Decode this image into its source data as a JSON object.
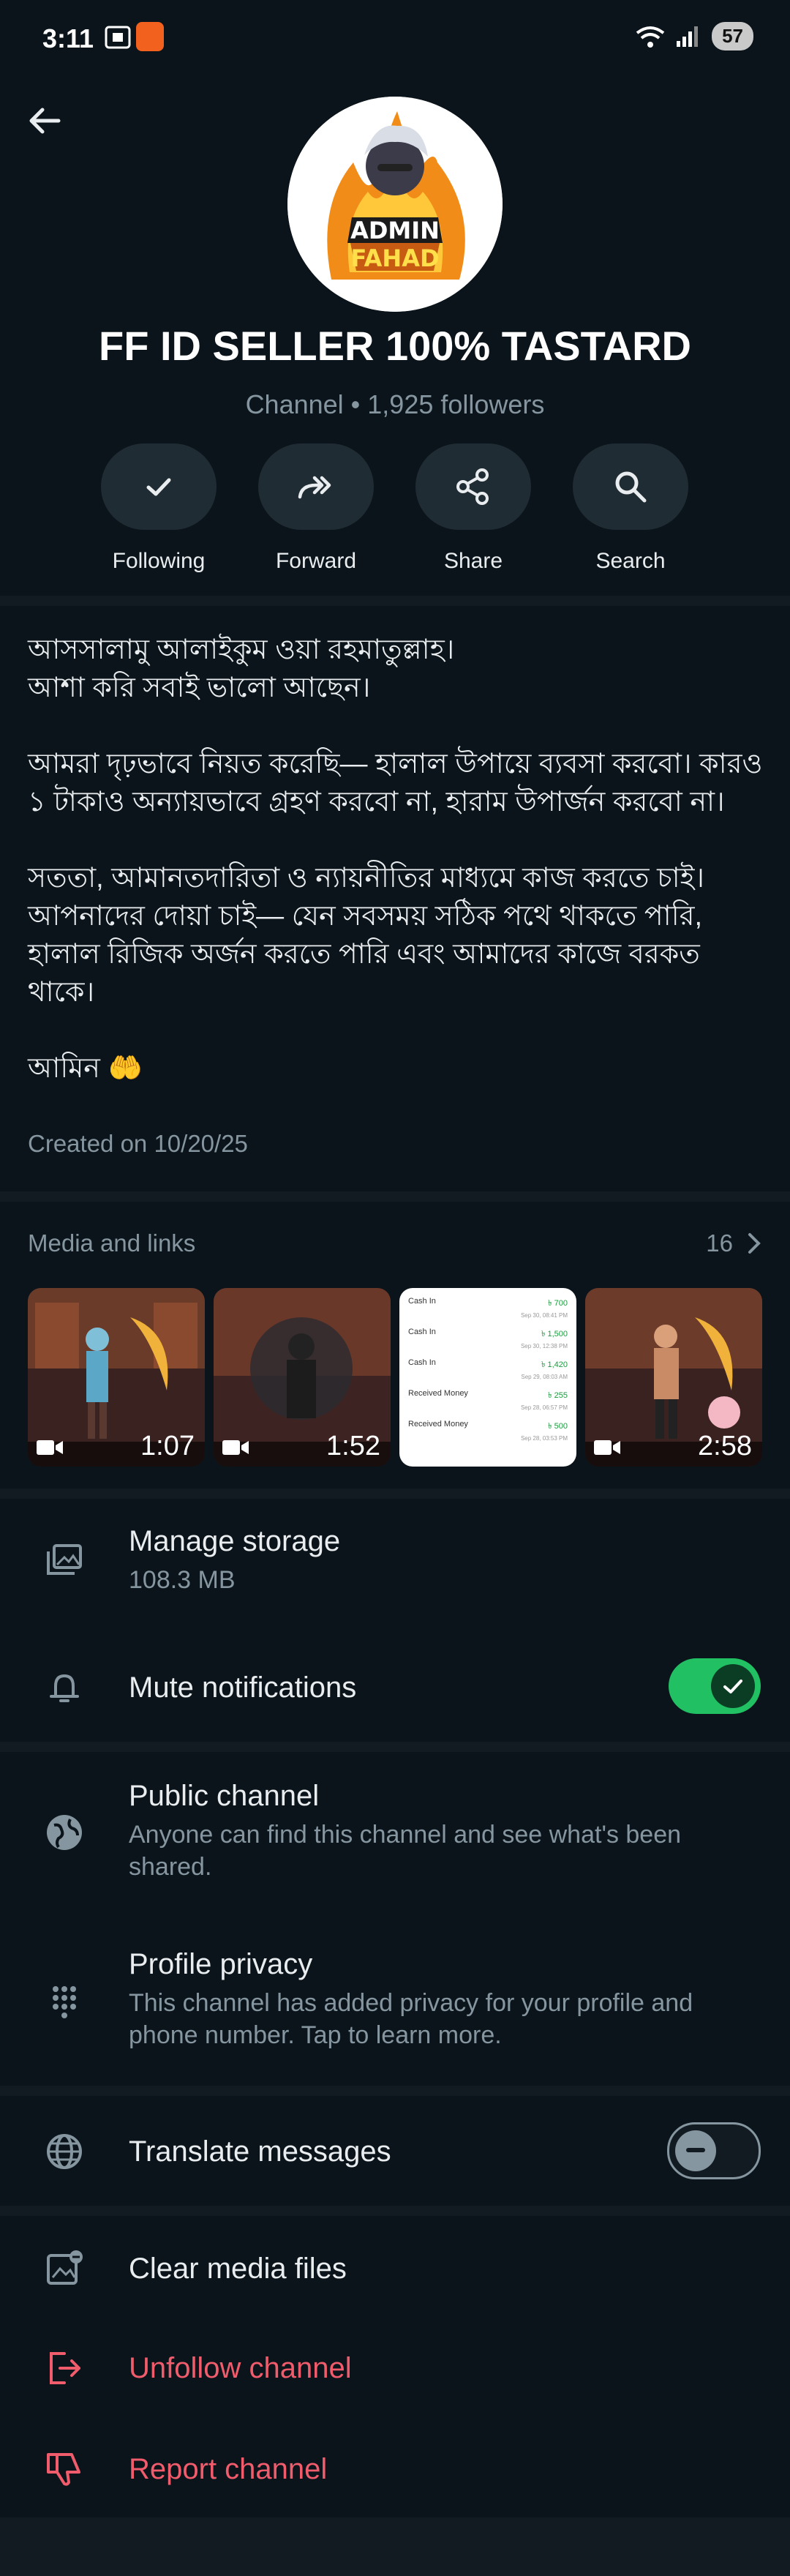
{
  "status": {
    "time": "3:11",
    "battery": "57"
  },
  "channel": {
    "name": "FF ID SELLER 100% TASTARD",
    "subtitle": "Channel • 1,925 followers",
    "avatar_text_top": "ADMIN",
    "avatar_text_bottom": "FAHAD"
  },
  "actions": [
    {
      "label": "Following",
      "icon": "check-icon"
    },
    {
      "label": "Forward",
      "icon": "forward-icon"
    },
    {
      "label": "Share",
      "icon": "share-icon"
    },
    {
      "label": "Search",
      "icon": "search-icon"
    }
  ],
  "description": {
    "p1_l1": "আসসালামু আলাইকুম ওয়া রহমাতুল্লাহ।",
    "p1_l2": "আশা করি সবাই ভালো আছেন।",
    "p2": "আমরা দৃঢ়ভাবে নিয়ত করেছি— হালাল উপায়ে ব্যবসা করবো। কারও ১ টাকাও অন্যায়ভাবে গ্রহণ করবো না, হারাম উপার্জন করবো না।",
    "p3": "সততা, আমানতদারিতা ও ন্যায়নীতির মাধ্যমে কাজ করতে চাই। আপনাদের দোয়া চাই— যেন সবসময় সঠিক পথে থাকতে পারি, হালাল রিজিক অর্জন করতে পারি এবং আমাদের কাজে বরকত থাকে।",
    "p4": "আমিন 🤲",
    "created": "Created on 10/20/25"
  },
  "media": {
    "heading": "Media and links",
    "count": "16",
    "items": [
      {
        "type": "video",
        "duration": "1:07"
      },
      {
        "type": "video",
        "duration": "1:52"
      },
      {
        "type": "image",
        "duration": ""
      },
      {
        "type": "video",
        "duration": "2:58"
      }
    ],
    "receipt_rows": [
      {
        "label": "Cash In",
        "amount": "৳ 700",
        "date": "Sep 30, 08:41 PM"
      },
      {
        "label": "Cash In",
        "amount": "৳ 1,500",
        "date": "Sep 30, 12:38 PM"
      },
      {
        "label": "Cash In",
        "amount": "৳ 1,420",
        "date": "Sep 29, 08:03 AM"
      },
      {
        "label": "Received Money",
        "amount": "৳ 255",
        "date": "Sep 28, 06:57 PM"
      },
      {
        "label": "Received Money",
        "amount": "৳ 500",
        "date": "Sep 28, 03:53 PM"
      }
    ]
  },
  "settings": {
    "manage_storage": {
      "label": "Manage storage",
      "value": "108.3 MB"
    },
    "mute": {
      "label": "Mute notifications",
      "enabled": true
    },
    "public": {
      "label": "Public channel",
      "desc": "Anyone can find this channel and see what's been shared."
    },
    "privacy": {
      "label": "Profile privacy",
      "desc": "This channel has added privacy for your profile and phone number. Tap to learn more."
    },
    "translate": {
      "label": "Translate messages",
      "enabled": false
    },
    "clear": {
      "label": "Clear media files"
    },
    "unfollow": {
      "label": "Unfollow channel"
    },
    "report": {
      "label": "Report channel"
    }
  },
  "colors": {
    "accent_green": "#21c063",
    "danger_red": "#f15c6d",
    "background": "#0b141a",
    "muted": "#8696a0"
  }
}
